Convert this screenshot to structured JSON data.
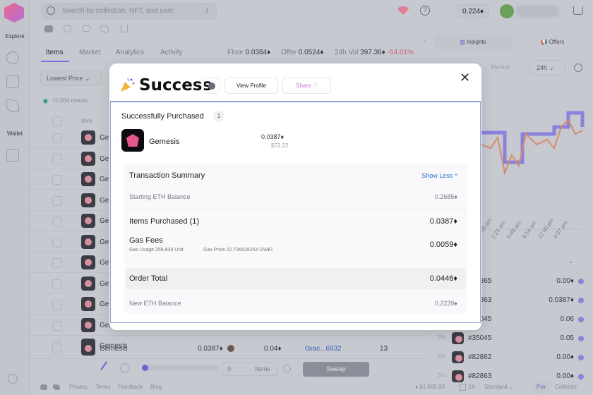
{
  "nav": {
    "explore_label": "Explore",
    "wallet_label": "Wallet",
    "search_placeholder": "Search by collection, NFT, and user",
    "search_shortcut": "/",
    "wallet_balance": "0.224♦"
  },
  "collection": {
    "tabs": [
      "Items",
      "Market",
      "Analytics",
      "Activity"
    ],
    "active_tab": "Items",
    "floor_label": "Floor",
    "floor_value": "0.0384♦",
    "offer_label": "Offer",
    "offer_value": "0.0524♦",
    "vol_label": "24h Vol",
    "vol_value": "397.36♦",
    "vol_change": "-54.01%",
    "sort_label": "Lowest Price",
    "results_label": "10,004 results",
    "column_item": "Item",
    "rows": [
      "Gemesis",
      "Gemesis",
      "Gemesis",
      "Gemesis",
      "Gemesis",
      "Gemesis",
      "Gemesis",
      "Gemesis",
      "Gemesis",
      "Gemesis",
      "Gemesis"
    ],
    "last_row": {
      "name": "Gemesis",
      "price": "0.0387♦",
      "last_sale": "0.04♦",
      "owner": "0xac...6932",
      "qty": "13"
    }
  },
  "sweep_bar": {
    "count": "0",
    "items_label": "Items",
    "sweep_label": "Sweep"
  },
  "footer": {
    "links": [
      "Privacy",
      "Terms",
      "Feedback",
      "Blog"
    ],
    "eth_price": "♦ $1,865.93",
    "gas": "24",
    "speed": "Standard",
    "mode_pro": "Pro",
    "mode_collector": "Collector"
  },
  "right_panel": {
    "tab_insights": "Insights",
    "tab_offers": "Offers",
    "sub_market": "Market",
    "timeframe": "24h",
    "x_ticks": [
      "10:55 pm",
      "2:21 am",
      "5:48 am",
      "9:14 am",
      "12:40 pm",
      "4:07 pm"
    ],
    "activity": [
      {
        "time": "",
        "id": "#82865",
        "price": "0.00♦"
      },
      {
        "time": "",
        "id": "#82863",
        "price": "0.0387♦"
      },
      {
        "time": "",
        "id": "#35045",
        "price": "0.06"
      },
      {
        "time": "38s",
        "id": "#35045",
        "price": "0.05"
      },
      {
        "time": "50s",
        "id": "#82862",
        "price": "0.00♦"
      },
      {
        "time": "50s",
        "id": "#82863",
        "price": "0.00♦"
      }
    ]
  },
  "modal": {
    "title": "Success",
    "view_profile": "View Profile",
    "share": "Share",
    "purchased_label": "Successfully Purchased",
    "purchased_count": "1",
    "item_name": "Gemesis",
    "item_price": "0.0387♦",
    "item_usd": "$72.22",
    "summary_title": "Transaction Summary",
    "show_less": "Show Less ^",
    "starting_label": "Starting ETH Balance",
    "starting_value": "0.2685♦",
    "items_label": "Items Purchased (1)",
    "items_value": "0.0387♦",
    "gas_label": "Gas Fees",
    "gas_usage": "Gas Usage 258,839 Unit",
    "gas_price": "Gas Price 22.736616254 GWEI",
    "gas_value": "0.0059♦",
    "total_label": "Order Total",
    "total_value": "0.0446♦",
    "new_label": "New ETH Balance",
    "new_value": "0.2239♦"
  }
}
